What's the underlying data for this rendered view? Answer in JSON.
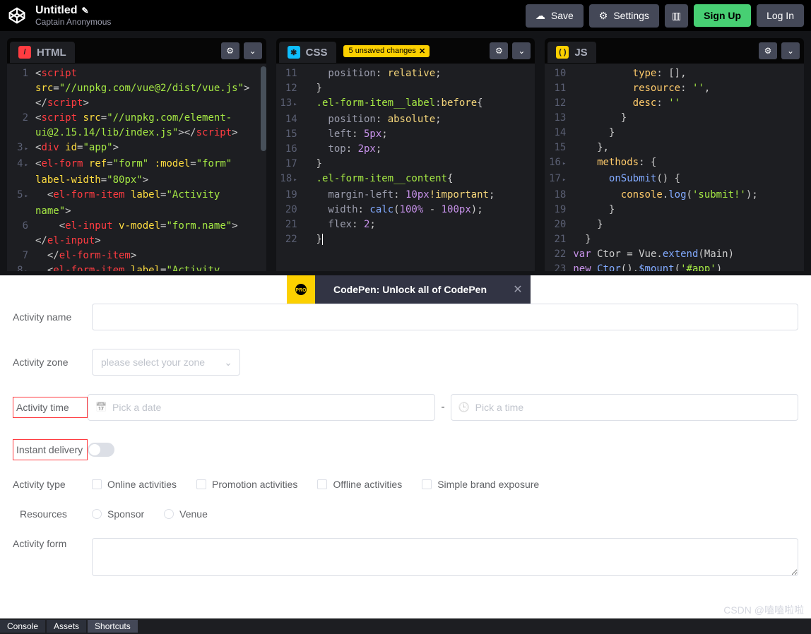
{
  "header": {
    "title": "Untitled",
    "author": "Captain Anonymous",
    "buttons": {
      "save": "Save",
      "settings": "Settings",
      "signup": "Sign Up",
      "login": "Log In"
    }
  },
  "editors": {
    "html": {
      "label": "HTML",
      "lines": [
        {
          "n": "1",
          "arrow": false,
          "html": "<span class='tok-punc'>&lt;</span><span class='tok-tag'>script</span>"
        },
        {
          "n": "",
          "arrow": false,
          "html": "<span class='tok-attr'>src</span><span class='tok-punc'>=</span><span class='tok-str'>\"//unpkg.com/vue@2/dist/vue.js\"</span><span class='tok-punc'>&gt;</span>"
        },
        {
          "n": "",
          "arrow": false,
          "html": "<span class='tok-punc'>&lt;/</span><span class='tok-tag'>script</span><span class='tok-punc'>&gt;</span>"
        },
        {
          "n": "2",
          "arrow": false,
          "html": "<span class='tok-punc'>&lt;</span><span class='tok-tag'>script</span> <span class='tok-attr'>src</span><span class='tok-punc'>=</span><span class='tok-str'>\"//unpkg.com/element-</span>"
        },
        {
          "n": "",
          "arrow": false,
          "html": "<span class='tok-str'>ui@2.15.14/lib/index.js\"</span><span class='tok-punc'>&gt;&lt;/</span><span class='tok-tag'>script</span><span class='tok-punc'>&gt;</span>"
        },
        {
          "n": "3",
          "arrow": true,
          "html": "<span class='tok-punc'>&lt;</span><span class='tok-tag'>div</span> <span class='tok-attr'>id</span><span class='tok-punc'>=</span><span class='tok-str'>\"app\"</span><span class='tok-punc'>&gt;</span>"
        },
        {
          "n": "4",
          "arrow": true,
          "html": "<span class='tok-punc'>&lt;</span><span class='tok-tag'>el-form</span> <span class='tok-attr'>ref</span><span class='tok-punc'>=</span><span class='tok-str'>\"form\"</span> <span class='tok-attr'>:model</span><span class='tok-punc'>=</span><span class='tok-str'>\"form\"</span>"
        },
        {
          "n": "",
          "arrow": false,
          "html": "<span class='tok-attr'>label-width</span><span class='tok-punc'>=</span><span class='tok-str'>\"80px\"</span><span class='tok-punc'>&gt;</span>"
        },
        {
          "n": "5",
          "arrow": true,
          "html": "  <span class='tok-punc'>&lt;</span><span class='tok-tag'>el-form-item</span> <span class='tok-attr'>label</span><span class='tok-punc'>=</span><span class='tok-str'>\"Activity</span>"
        },
        {
          "n": "",
          "arrow": false,
          "html": "<span class='tok-str'>name\"</span><span class='tok-punc'>&gt;</span>"
        },
        {
          "n": "6",
          "arrow": false,
          "html": "    <span class='tok-punc'>&lt;</span><span class='tok-tag'>el-input</span> <span class='tok-attr'>v-model</span><span class='tok-punc'>=</span><span class='tok-str'>\"form.name\"</span><span class='tok-punc'>&gt;</span>"
        },
        {
          "n": "",
          "arrow": false,
          "html": "<span class='tok-punc'>&lt;/</span><span class='tok-tag'>el-input</span><span class='tok-punc'>&gt;</span>"
        },
        {
          "n": "7",
          "arrow": false,
          "html": "  <span class='tok-punc'>&lt;/</span><span class='tok-tag'>el-form-item</span><span class='tok-punc'>&gt;</span>"
        },
        {
          "n": "8",
          "arrow": true,
          "html": "  <span class='tok-punc'>&lt;</span><span class='tok-tag'>el-form-item</span> <span class='tok-attr'>label</span><span class='tok-punc'>=</span><span class='tok-str'>\"Activity</span>"
        }
      ]
    },
    "css": {
      "label": "CSS",
      "unsaved": "5 unsaved changes",
      "lines": [
        {
          "n": "11",
          "arrow": false,
          "html": "    <span class='tok-prop'>position</span><span class='tok-punc'>:</span> <span class='tok-val'>relative</span><span class='tok-punc'>;</span>"
        },
        {
          "n": "12",
          "arrow": false,
          "html": "  <span class='tok-punc'>}</span>"
        },
        {
          "n": "13",
          "arrow": true,
          "html": "  <span class='tok-sel'>.el-form-item__label</span><span class='tok-punc'>:</span><span class='tok-val'>before</span><span class='tok-punc'>{</span>"
        },
        {
          "n": "14",
          "arrow": false,
          "html": "    <span class='tok-prop'>position</span><span class='tok-punc'>:</span> <span class='tok-val'>absolute</span><span class='tok-punc'>;</span>"
        },
        {
          "n": "15",
          "arrow": false,
          "html": "    <span class='tok-prop'>left</span><span class='tok-punc'>:</span> <span class='tok-num'>5px</span><span class='tok-punc'>;</span>"
        },
        {
          "n": "16",
          "arrow": false,
          "html": "    <span class='tok-prop'>top</span><span class='tok-punc'>:</span> <span class='tok-num'>2px</span><span class='tok-punc'>;</span>"
        },
        {
          "n": "17",
          "arrow": false,
          "html": "  <span class='tok-punc'>}</span>"
        },
        {
          "n": "18",
          "arrow": true,
          "html": "  <span class='tok-sel'>.el-form-item__content</span><span class='tok-punc'>{</span>"
        },
        {
          "n": "19",
          "arrow": false,
          "html": "    <span class='tok-prop'>margin-left</span><span class='tok-punc'>:</span> <span class='tok-num'>10px</span><span class='tok-val'>!important</span><span class='tok-punc'>;</span>"
        },
        {
          "n": "20",
          "arrow": false,
          "html": "    <span class='tok-prop'>width</span><span class='tok-punc'>:</span> <span class='tok-fn'>calc</span><span class='tok-punc'>(</span><span class='tok-num'>100%</span> <span class='tok-punc'>-</span> <span class='tok-num'>100px</span><span class='tok-punc'>);</span>"
        },
        {
          "n": "21",
          "arrow": false,
          "html": "    <span class='tok-prop'>flex</span><span class='tok-punc'>:</span> <span class='tok-num'>2</span><span class='tok-punc'>;</span>"
        },
        {
          "n": "22",
          "arrow": false,
          "html": "  <span class='tok-punc'>}</span><span style='border-left:1px solid #fff;'>&nbsp;</span>"
        }
      ]
    },
    "js": {
      "label": "JS",
      "lines": [
        {
          "n": "10",
          "arrow": false,
          "html": "          <span class='tok-id'>type</span><span class='tok-punc'>: [],</span>"
        },
        {
          "n": "11",
          "arrow": false,
          "html": "          <span class='tok-id'>resource</span><span class='tok-punc'>:</span> <span class='tok-str'>''</span><span class='tok-punc'>,</span>"
        },
        {
          "n": "12",
          "arrow": false,
          "html": "          <span class='tok-id'>desc</span><span class='tok-punc'>:</span> <span class='tok-str'>''</span>"
        },
        {
          "n": "13",
          "arrow": false,
          "html": "        <span class='tok-punc'>}</span>"
        },
        {
          "n": "14",
          "arrow": false,
          "html": "      <span class='tok-punc'>}</span>"
        },
        {
          "n": "15",
          "arrow": false,
          "html": "    <span class='tok-punc'>},</span>"
        },
        {
          "n": "16",
          "arrow": true,
          "html": "    <span class='tok-id'>methods</span><span class='tok-punc'>: {</span>"
        },
        {
          "n": "17",
          "arrow": true,
          "html": "      <span class='tok-fn'>onSubmit</span><span class='tok-punc'>() {</span>"
        },
        {
          "n": "18",
          "arrow": false,
          "html": "        <span class='tok-id'>console</span><span class='tok-punc'>.</span><span class='tok-fn'>log</span><span class='tok-punc'>(</span><span class='tok-str'>'submit!'</span><span class='tok-punc'>);</span>"
        },
        {
          "n": "19",
          "arrow": false,
          "html": "      <span class='tok-punc'>}</span>"
        },
        {
          "n": "20",
          "arrow": false,
          "html": "    <span class='tok-punc'>}</span>"
        },
        {
          "n": "21",
          "arrow": false,
          "html": "  <span class='tok-punc'>}</span>"
        },
        {
          "n": "22",
          "arrow": false,
          "html": "<span class='tok-kw'>var</span> <span class='tok-plain'>Ctor</span> <span class='tok-punc'>=</span> <span class='tok-plain'>Vue</span><span class='tok-punc'>.</span><span class='tok-fn'>extend</span><span class='tok-punc'>(</span><span class='tok-plain'>Main</span><span class='tok-punc'>)</span>"
        },
        {
          "n": "23",
          "arrow": false,
          "html": "<span class='tok-kw'>new</span> <span class='tok-fn'>Ctor</span><span class='tok-punc'>().</span><span class='tok-fn'>$mount</span><span class='tok-punc'>(</span><span class='tok-str'>'#app'</span><span class='tok-punc'>)</span>"
        }
      ]
    }
  },
  "promo": {
    "text": "CodePen: Unlock all of CodePen"
  },
  "form": {
    "activity_name": "Activity name",
    "activity_zone": "Activity zone",
    "zone_placeholder": "please select your zone",
    "activity_time": "Activity time",
    "date_placeholder": "Pick a date",
    "time_placeholder": "Pick a time",
    "instant_delivery": "Instant delivery",
    "activity_type": "Activity type",
    "types": [
      "Online activities",
      "Promotion activities",
      "Offline activities",
      "Simple brand exposure"
    ],
    "resources": "Resources",
    "res_opts": [
      "Sponsor",
      "Venue"
    ],
    "activity_form": "Activity form"
  },
  "footer": {
    "console": "Console",
    "assets": "Assets",
    "shortcuts": "Shortcuts"
  },
  "watermark": "CSDN @嗑嗑啦啦"
}
